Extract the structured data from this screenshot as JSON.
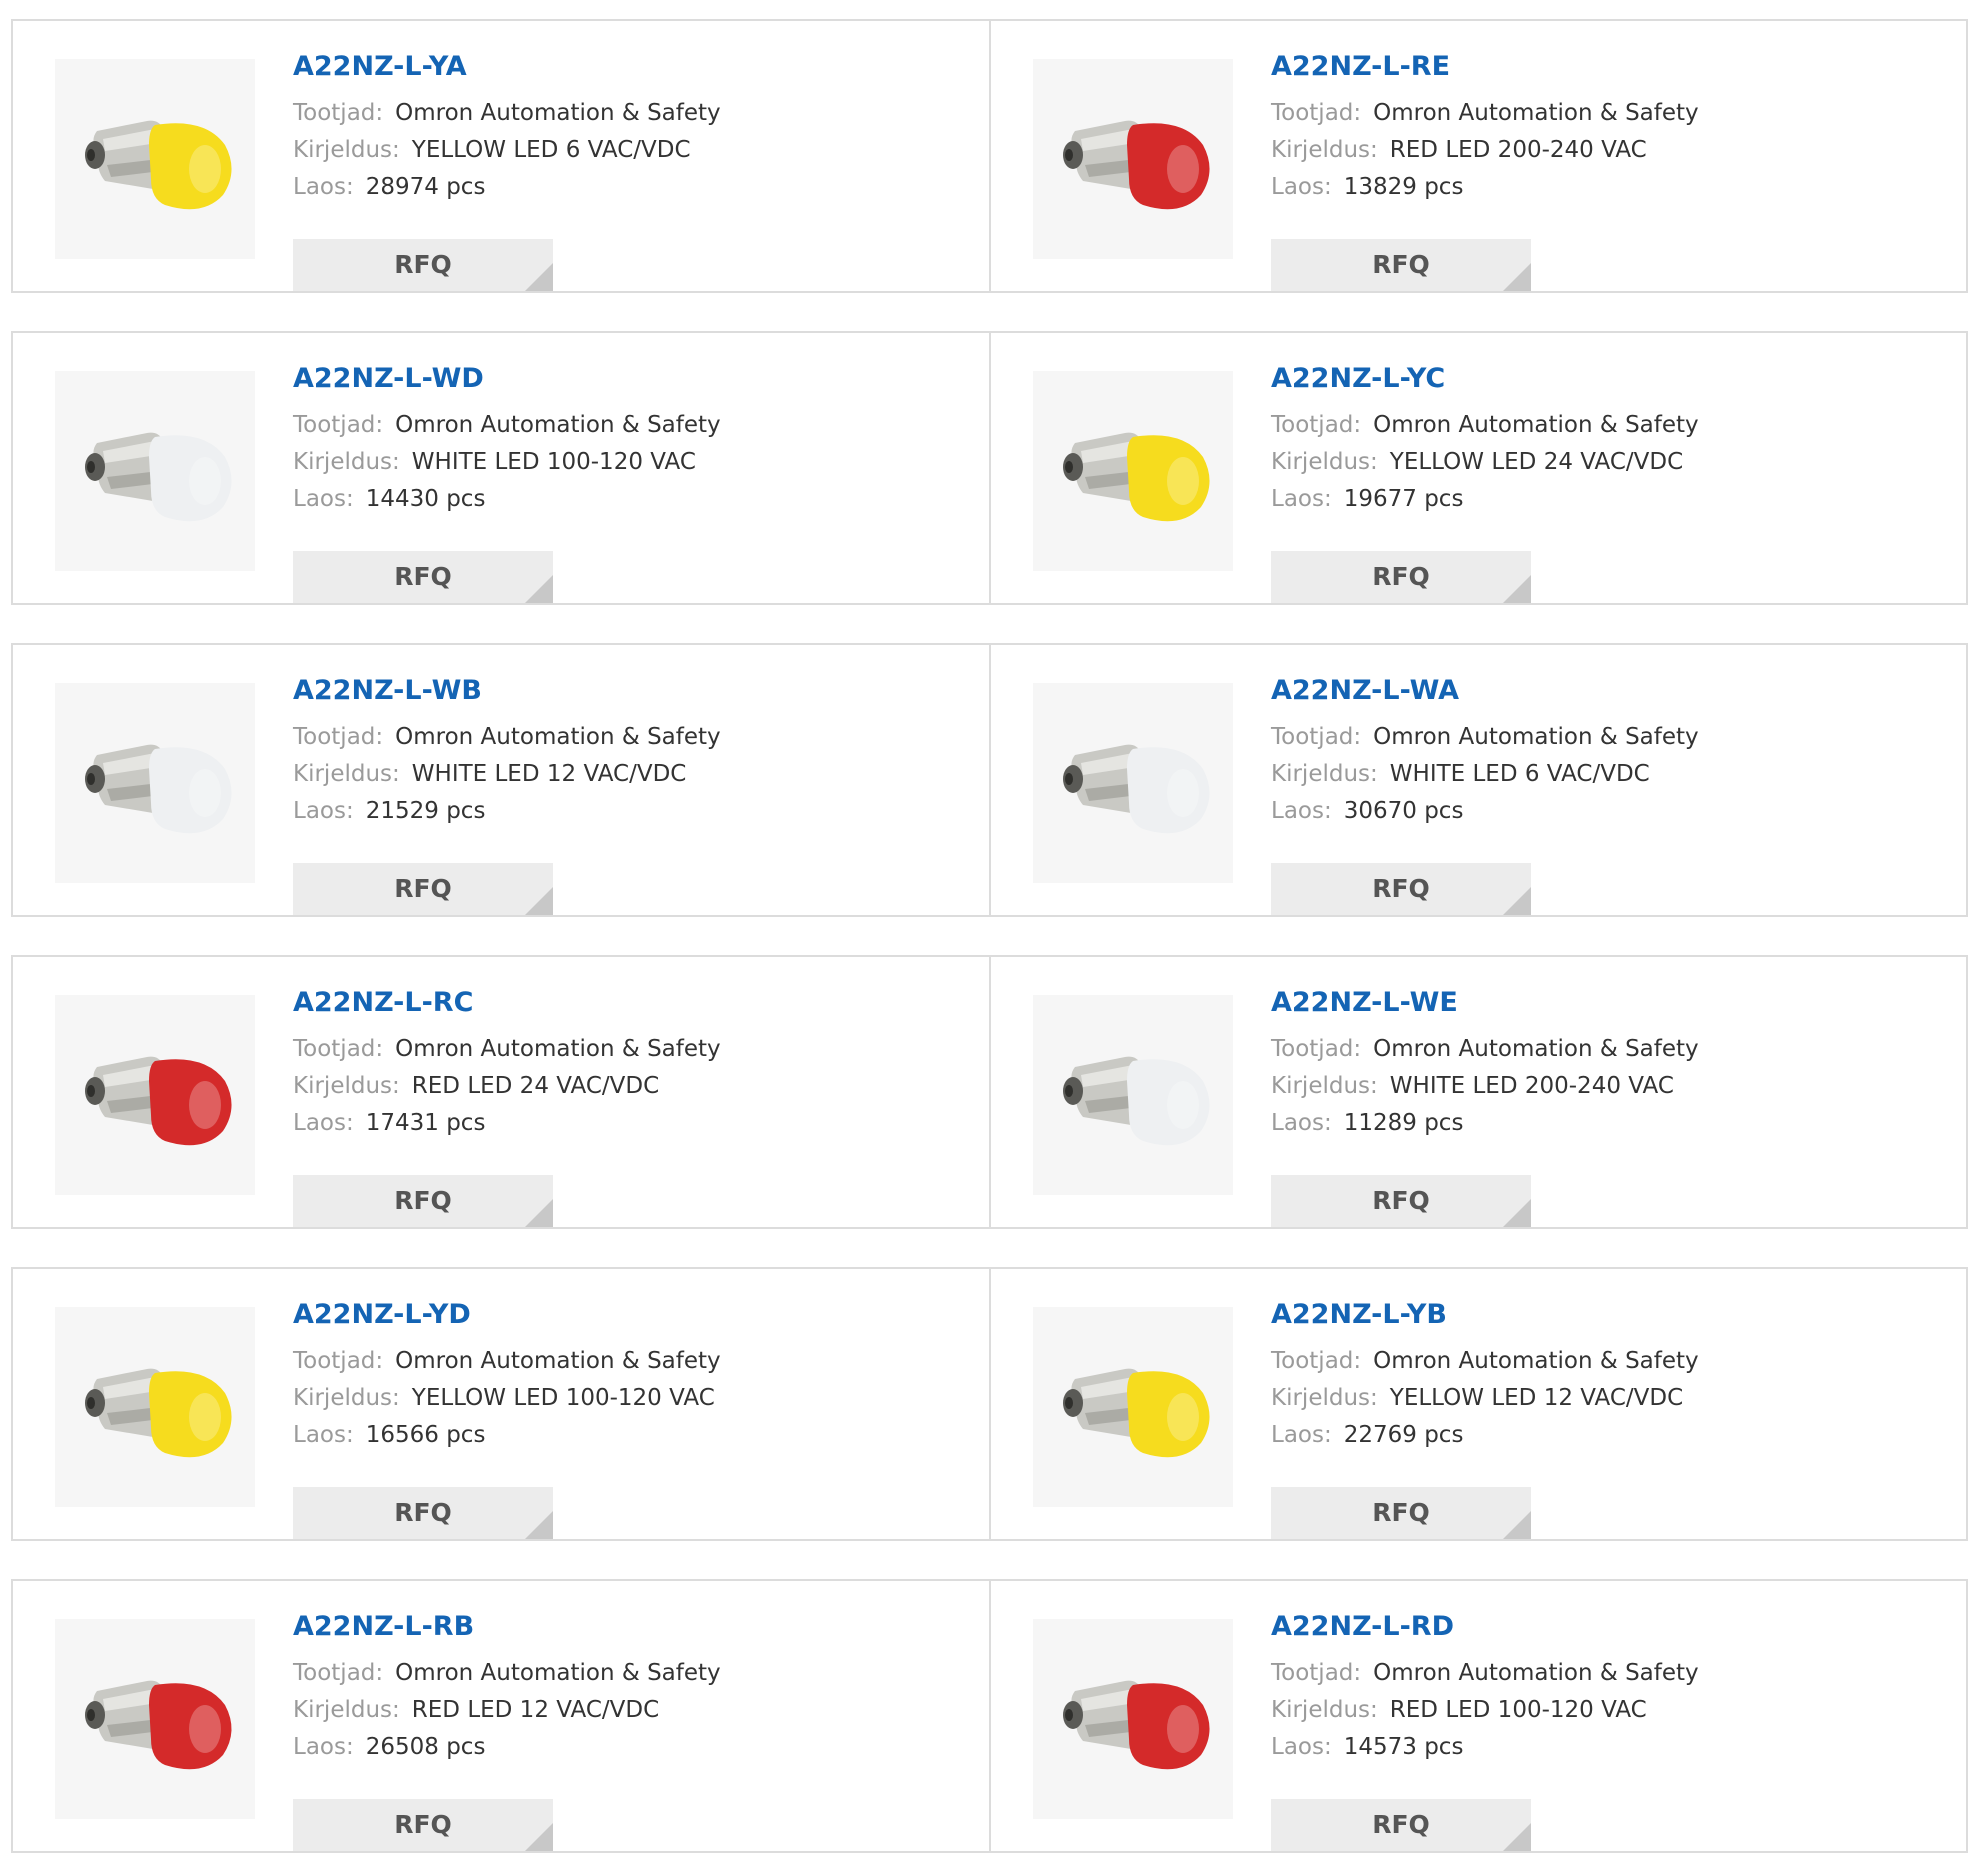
{
  "labels": {
    "manufacturer": "Tootjad:",
    "description": "Kirjeldus:",
    "stock": "Laos:",
    "rfq": "RFQ"
  },
  "products": [
    {
      "part": "A22NZ-L-YA",
      "manufacturer": "Omron Automation & Safety",
      "description": "YELLOW LED 6 VAC/VDC",
      "stock": "28974 pcs",
      "color": "yellow"
    },
    {
      "part": "A22NZ-L-RE",
      "manufacturer": "Omron Automation & Safety",
      "description": "RED LED 200-240 VAC",
      "stock": "13829 pcs",
      "color": "red"
    },
    {
      "part": "A22NZ-L-WD",
      "manufacturer": "Omron Automation & Safety",
      "description": "WHITE LED 100-120 VAC",
      "stock": "14430 pcs",
      "color": "white"
    },
    {
      "part": "A22NZ-L-YC",
      "manufacturer": "Omron Automation & Safety",
      "description": "YELLOW LED 24 VAC/VDC",
      "stock": "19677 pcs",
      "color": "yellow"
    },
    {
      "part": "A22NZ-L-WB",
      "manufacturer": "Omron Automation & Safety",
      "description": "WHITE LED 12 VAC/VDC",
      "stock": "21529 pcs",
      "color": "white"
    },
    {
      "part": "A22NZ-L-WA",
      "manufacturer": "Omron Automation & Safety",
      "description": "WHITE LED 6 VAC/VDC",
      "stock": "30670 pcs",
      "color": "white"
    },
    {
      "part": "A22NZ-L-RC",
      "manufacturer": "Omron Automation & Safety",
      "description": "RED LED 24 VAC/VDC",
      "stock": "17431 pcs",
      "color": "red"
    },
    {
      "part": "A22NZ-L-WE",
      "manufacturer": "Omron Automation & Safety",
      "description": "WHITE LED 200-240 VAC",
      "stock": "11289 pcs",
      "color": "white"
    },
    {
      "part": "A22NZ-L-YD",
      "manufacturer": "Omron Automation & Safety",
      "description": "YELLOW LED 100-120 VAC",
      "stock": "16566 pcs",
      "color": "yellow"
    },
    {
      "part": "A22NZ-L-YB",
      "manufacturer": "Omron Automation & Safety",
      "description": "YELLOW LED 12 VAC/VDC",
      "stock": "22769 pcs",
      "color": "yellow"
    },
    {
      "part": "A22NZ-L-RB",
      "manufacturer": "Omron Automation & Safety",
      "description": "RED LED 12 VAC/VDC",
      "stock": "26508 pcs",
      "color": "red"
    },
    {
      "part": "A22NZ-L-RD",
      "manufacturer": "Omron Automation & Safety",
      "description": "RED LED 100-120 VAC",
      "stock": "14573 pcs",
      "color": "red"
    }
  ],
  "lens_colors": {
    "yellow": "#f6dc1e",
    "red": "#d42a2a",
    "white": "#eef0f2"
  },
  "colors": {
    "part_link": "#1464b4",
    "label_text": "#9a9a9a",
    "value_text": "#333333",
    "rfq_bg": "#ececec",
    "border": "#dcdcdc"
  }
}
